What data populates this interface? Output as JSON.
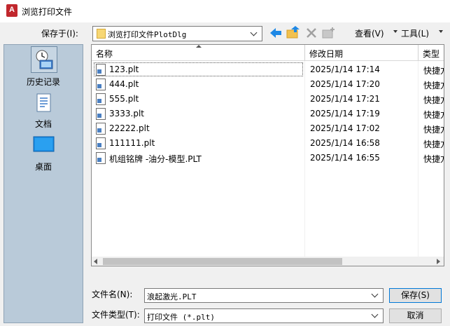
{
  "window": {
    "title": "浏览打印文件",
    "app_icon_letter": "A"
  },
  "toolbar": {
    "save_in_label": "保存于(I):",
    "save_in_value": "浏览打印文件PlotDlg",
    "view_label": "查看(V)",
    "tools_label": "工具(L)"
  },
  "places": [
    {
      "label": "历史记录",
      "icon": "history-icon"
    },
    {
      "label": "文档",
      "icon": "documents-icon"
    },
    {
      "label": "桌面",
      "icon": "desktop-icon"
    }
  ],
  "columns": {
    "name": "名称",
    "date": "修改日期",
    "type": "类型"
  },
  "files": [
    {
      "name": "123.plt",
      "date": "2025/1/14 17:14",
      "type": "快捷方"
    },
    {
      "name": "444.plt",
      "date": "2025/1/14 17:20",
      "type": "快捷方"
    },
    {
      "name": "555.plt",
      "date": "2025/1/14 17:21",
      "type": "快捷方"
    },
    {
      "name": "3333.plt",
      "date": "2025/1/14 17:19",
      "type": "快捷方"
    },
    {
      "name": "22222.plt",
      "date": "2025/1/14 17:02",
      "type": "快捷方"
    },
    {
      "name": "111111.plt",
      "date": "2025/1/14 16:58",
      "type": "快捷方"
    },
    {
      "name": "机组铭牌 -油分-模型.PLT",
      "date": "2025/1/14 16:55",
      "type": "快捷方"
    }
  ],
  "bottom": {
    "filename_label": "文件名(N):",
    "filename_value": "浪起激光.PLT",
    "filetype_label": "文件类型(T):",
    "filetype_value": "打印文件 (*.plt)",
    "save_button": "保存(S)",
    "cancel_button": "取消"
  },
  "colors": {
    "accent": "#0078d7",
    "places_bg": "#b9cad9",
    "app_icon": "#c1272d"
  }
}
